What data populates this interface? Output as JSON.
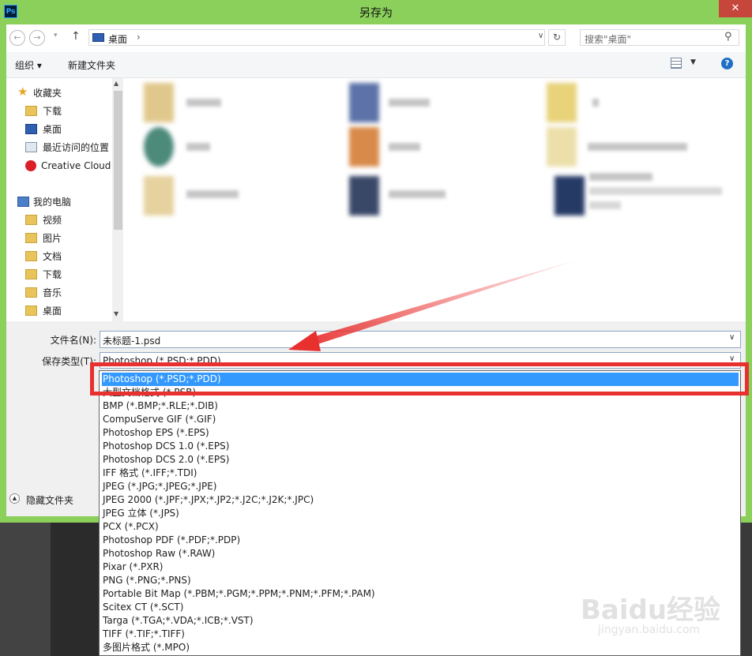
{
  "window": {
    "app_icon": "Ps",
    "title": "另存为",
    "close_label": "✕"
  },
  "address": {
    "back_icon": "back-arrow-icon",
    "forward_icon": "forward-arrow-icon",
    "up_icon": "up-arrow-icon",
    "path": "桌面",
    "search_placeholder": "搜索\"桌面\""
  },
  "toolbar": {
    "organize_label": "组织 ▾",
    "new_folder_label": "新建文件夹"
  },
  "sidebar": {
    "items": [
      {
        "label": "收藏夹",
        "icon": "star-icon"
      },
      {
        "label": "下载",
        "icon": "download-folder-icon"
      },
      {
        "label": "桌面",
        "icon": "desktop-icon"
      },
      {
        "label": "最近访问的位置",
        "icon": "recent-places-icon"
      },
      {
        "label": "Creative Cloud",
        "icon": "creative-cloud-icon"
      },
      {
        "label": "我的电脑",
        "icon": "computer-icon"
      },
      {
        "label": "视频",
        "icon": "videos-folder-icon"
      },
      {
        "label": "图片",
        "icon": "pictures-folder-icon"
      },
      {
        "label": "文档",
        "icon": "documents-folder-icon"
      },
      {
        "label": "下载",
        "icon": "download-folder-icon"
      },
      {
        "label": "音乐",
        "icon": "music-folder-icon"
      },
      {
        "label": "桌面",
        "icon": "desktop-icon"
      }
    ]
  },
  "form": {
    "filename_label": "文件名(N):",
    "filename_value": "未标题-1.psd",
    "filetype_label": "保存类型(T):",
    "filetype_value": "Photoshop (*.PSD;*.PDD)",
    "hide_folders_label": "隐藏文件夹"
  },
  "file_types": [
    "Photoshop (*.PSD;*.PDD)",
    "大型文档格式 (*.PSB)",
    "BMP (*.BMP;*.RLE;*.DIB)",
    "CompuServe GIF (*.GIF)",
    "Photoshop EPS (*.EPS)",
    "Photoshop DCS 1.0 (*.EPS)",
    "Photoshop DCS 2.0 (*.EPS)",
    "IFF 格式 (*.IFF;*.TDI)",
    "JPEG (*.JPG;*.JPEG;*.JPE)",
    "JPEG 2000 (*.JPF;*.JPX;*.JP2;*.J2C;*.J2K;*.JPC)",
    "JPEG 立体 (*.JPS)",
    "PCX (*.PCX)",
    "Photoshop PDF (*.PDF;*.PDP)",
    "Photoshop Raw (*.RAW)",
    "Pixar (*.PXR)",
    "PNG (*.PNG;*.PNS)",
    "Portable Bit Map (*.PBM;*.PGM;*.PPM;*.PNM;*.PFM;*.PAM)",
    "Scitex CT (*.SCT)",
    "Targa (*.TGA;*.VDA;*.ICB;*.VST)",
    "TIFF (*.TIF;*.TIFF)",
    "多图片格式 (*.MPO)"
  ],
  "selected_index": 0,
  "colors": {
    "window_frame": "#8bd05a",
    "selection": "#3399ff",
    "annotation": "#e8302e"
  },
  "watermark": {
    "logo": "Baidu经验",
    "url": "jingyan.baidu.com"
  }
}
